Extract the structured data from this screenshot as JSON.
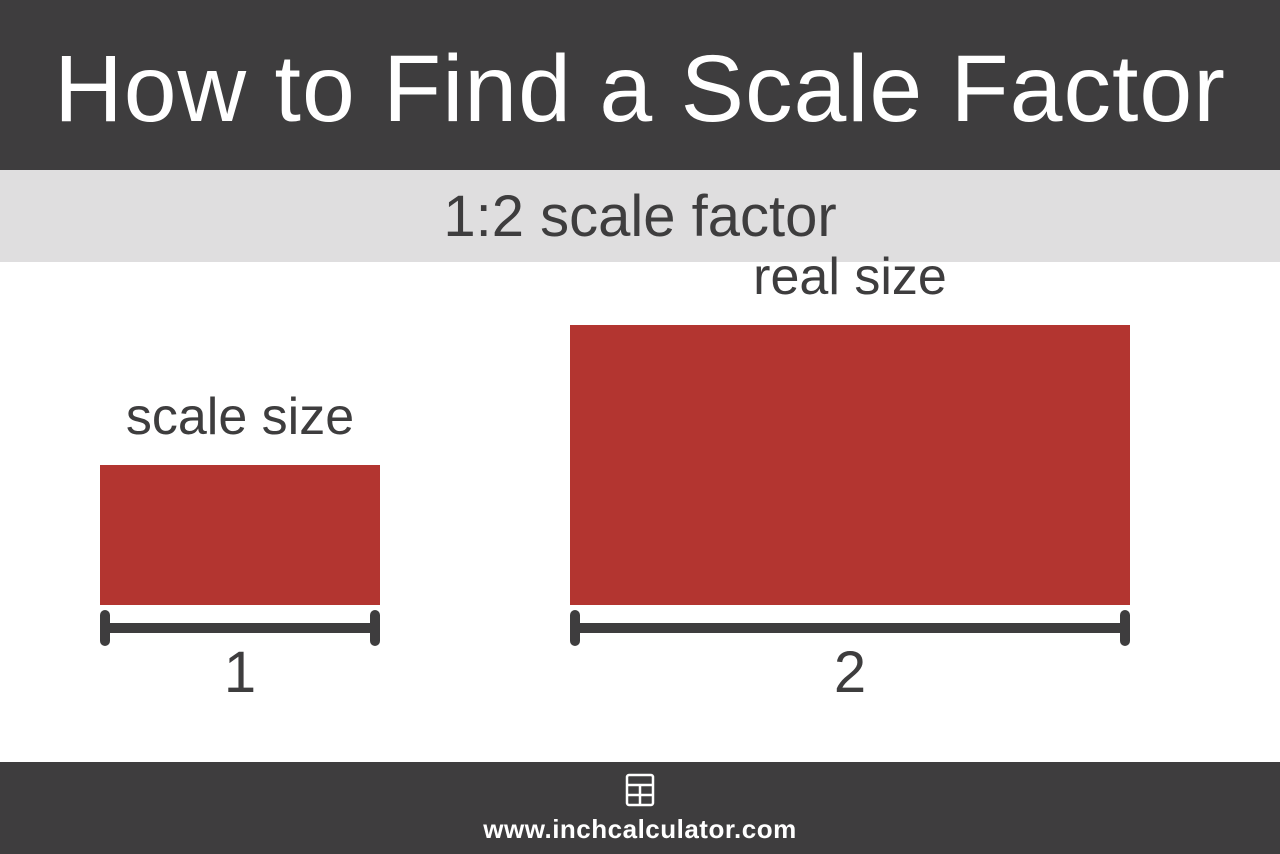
{
  "header": {
    "title": "How to Find a Scale Factor"
  },
  "subheader": {
    "text": "1:2 scale factor"
  },
  "diagram": {
    "small": {
      "label": "scale size",
      "measure": "1"
    },
    "large": {
      "label": "real size",
      "measure": "2"
    }
  },
  "footer": {
    "url": "www.inchcalculator.com"
  },
  "colors": {
    "dark": "#3e3d3e",
    "light_gray": "#dfdedf",
    "rect": "#b33530",
    "white": "#ffffff"
  }
}
